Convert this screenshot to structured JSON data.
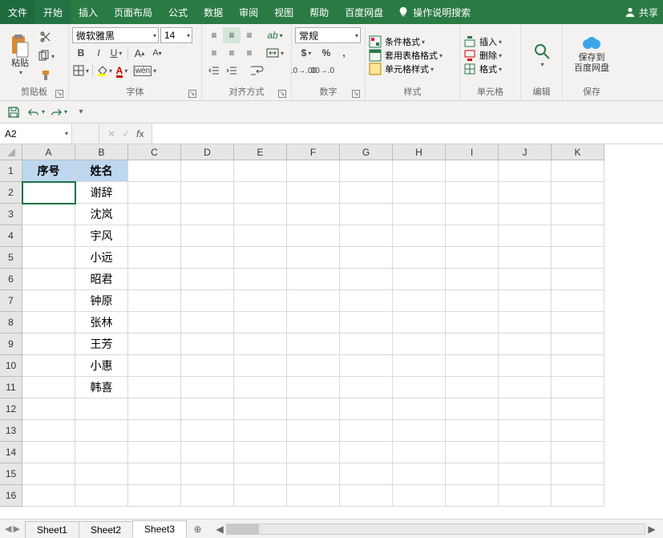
{
  "tabs": {
    "file": "文件",
    "home": "开始",
    "insert": "插入",
    "layout": "页面布局",
    "formulas": "公式",
    "data": "数据",
    "review": "审阅",
    "view": "视图",
    "help": "帮助",
    "baidu": "百度网盘",
    "tell": "操作说明搜索",
    "share": "共享"
  },
  "ribbon": {
    "clipboard": {
      "paste": "粘贴",
      "label": "剪贴板"
    },
    "font": {
      "name": "微软雅黑",
      "size": "14",
      "label": "字体"
    },
    "alignment": {
      "label": "对齐方式"
    },
    "number": {
      "format": "常规",
      "label": "数字"
    },
    "styles": {
      "cond": "条件格式",
      "table": "套用表格格式",
      "cell": "单元格样式",
      "label": "样式"
    },
    "cells": {
      "insert": "插入",
      "delete": "删除",
      "format": "格式",
      "label": "单元格"
    },
    "editing": {
      "label": "编辑"
    },
    "save": {
      "btn": "保存到\n百度网盘",
      "label": "保存"
    }
  },
  "namebox": "A2",
  "sheet": {
    "cols": [
      "A",
      "B",
      "C",
      "D",
      "E",
      "F",
      "G",
      "H",
      "I",
      "J",
      "K"
    ],
    "rows": 16,
    "header": {
      "A": "序号",
      "B": "姓名"
    },
    "names": [
      "谢辞",
      "沈岚",
      "宇风",
      "小远",
      "昭君",
      "钟原",
      "张林",
      "王芳",
      "小惠",
      "韩喜"
    ],
    "selected": "A2"
  },
  "sheets": [
    "Sheet1",
    "Sheet2",
    "Sheet3"
  ],
  "activeSheet": "Sheet3"
}
